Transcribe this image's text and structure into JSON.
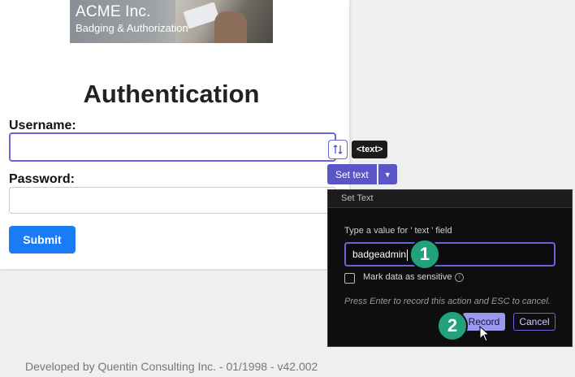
{
  "banner": {
    "company": "ACME Inc.",
    "tagline": "Badging & Authorization"
  },
  "form": {
    "title": "Authentication",
    "username_label": "Username:",
    "username_value": "",
    "password_label": "Password:",
    "password_value": "",
    "submit_label": "Submit"
  },
  "footer": {
    "text": "Developed by Quentin Consulting Inc. - 01/1998 - v42.002"
  },
  "recorder": {
    "element_tag": "<text>",
    "action_label": "Set text",
    "action_icons": [
      "swap-icon",
      "chevron-down-icon"
    ],
    "panel_title": "Set Text",
    "prompt": "Type a value for ' text ' field",
    "value": "badgeadmin",
    "sensitive_label": "Mark data as sensitive",
    "sensitive_checked": false,
    "hint": "Press Enter to record this action and ESC to cancel.",
    "record_label": "Record",
    "cancel_label": "Cancel"
  },
  "steps": {
    "one": "1",
    "two": "2"
  },
  "colors": {
    "accent": "#5a56c8",
    "focus": "#6b66d8",
    "submit": "#1a7cf5",
    "step_badge": "#22a27a",
    "panel_bg": "#0e0e10"
  }
}
